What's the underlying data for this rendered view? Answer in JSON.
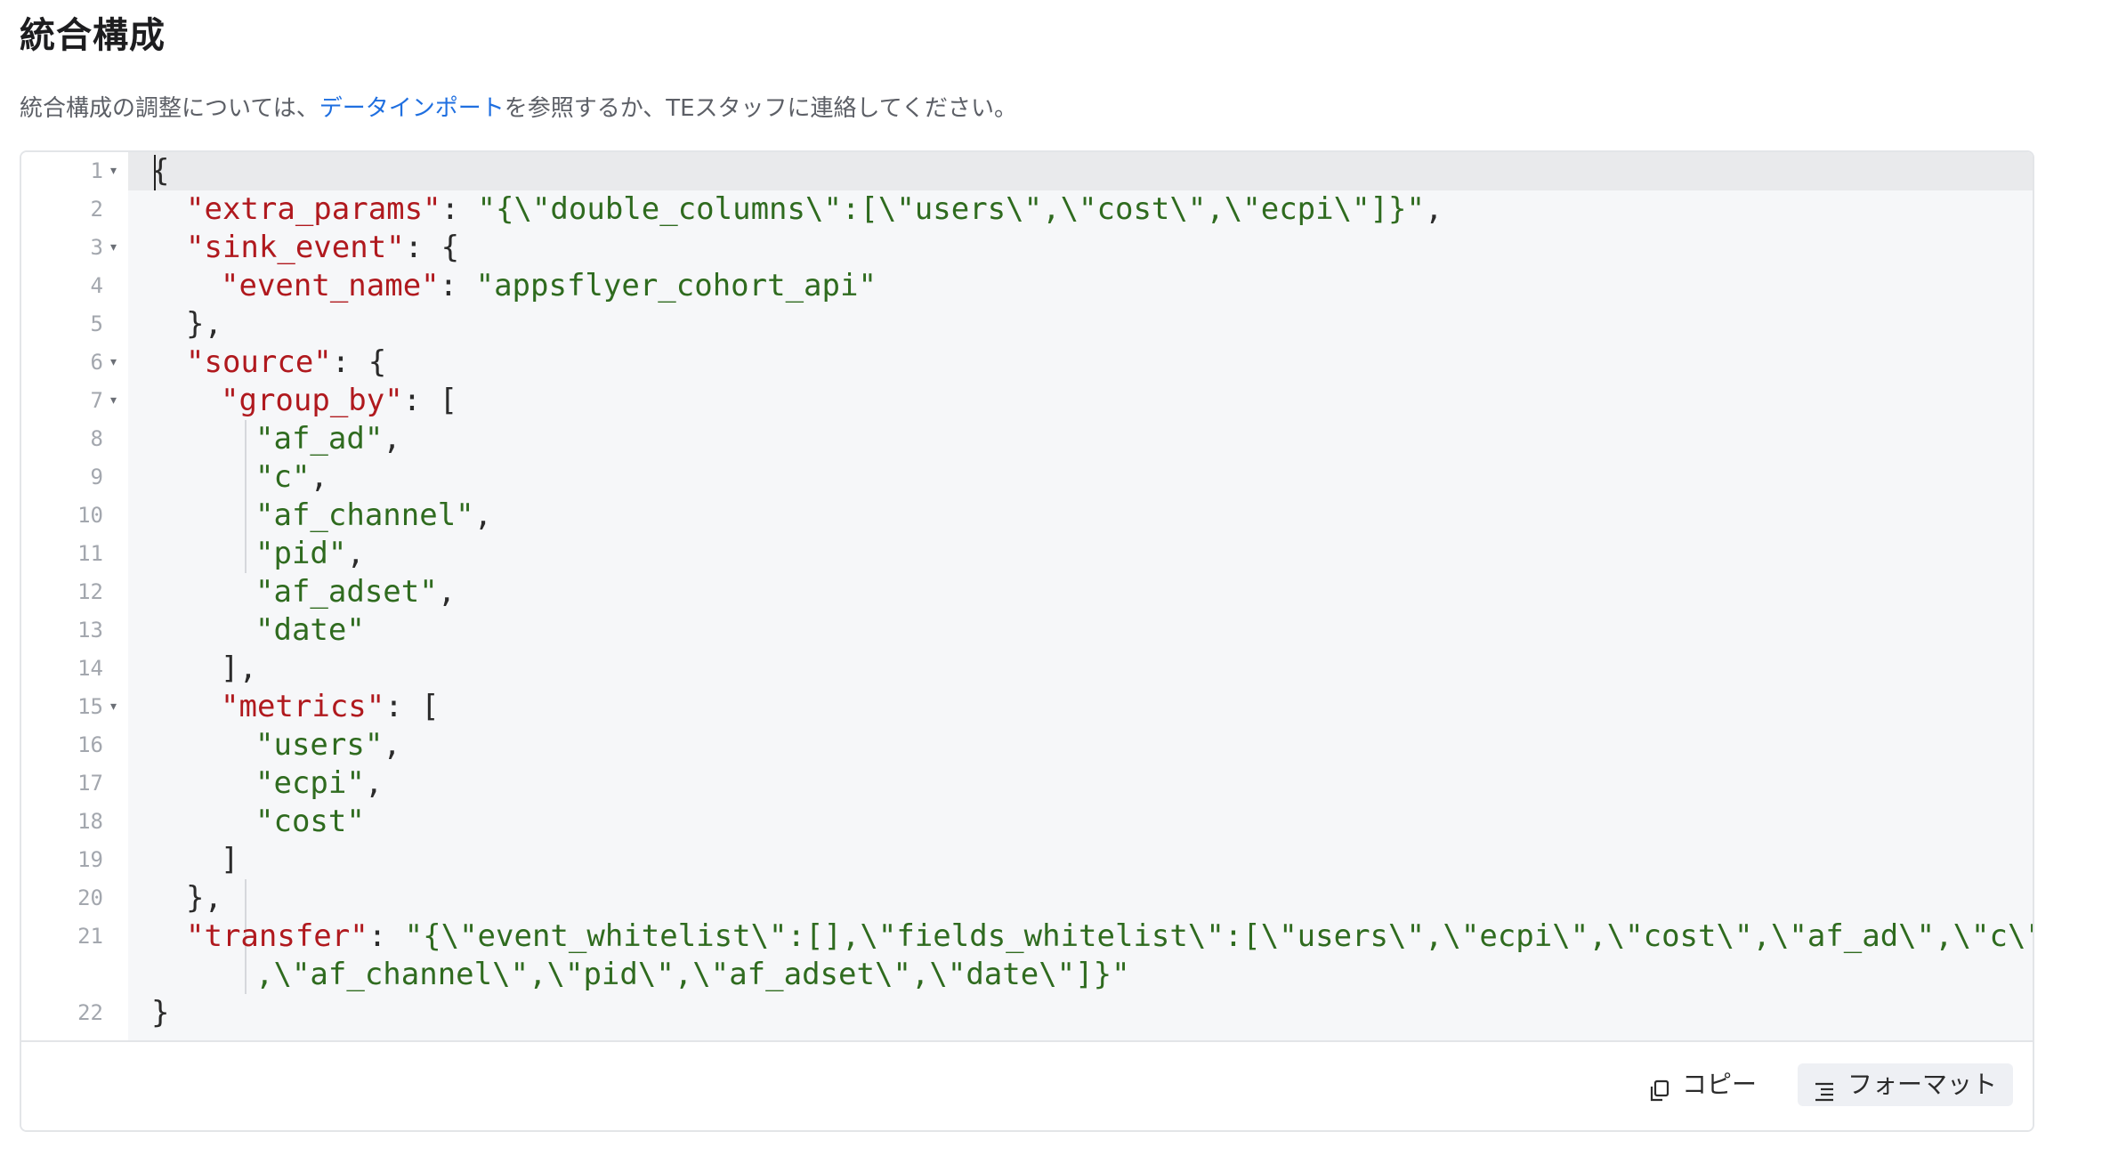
{
  "page": {
    "title": "統合構成",
    "desc_prefix": "統合構成の調整については、",
    "desc_link": "データインポート",
    "desc_suffix": "を参照するか、TEスタッフに連絡してください。"
  },
  "editor": {
    "lines": [
      {
        "n": "1",
        "fold": true
      },
      {
        "n": "2"
      },
      {
        "n": "3",
        "fold": true
      },
      {
        "n": "4"
      },
      {
        "n": "5"
      },
      {
        "n": "6",
        "fold": true
      },
      {
        "n": "7",
        "fold": true
      },
      {
        "n": "8"
      },
      {
        "n": "9"
      },
      {
        "n": "10"
      },
      {
        "n": "11"
      },
      {
        "n": "12"
      },
      {
        "n": "13"
      },
      {
        "n": "14"
      },
      {
        "n": "15",
        "fold": true
      },
      {
        "n": "16"
      },
      {
        "n": "17"
      },
      {
        "n": "18"
      },
      {
        "n": "19"
      },
      {
        "n": "20"
      },
      {
        "n": "21"
      },
      {
        "n": "22"
      }
    ],
    "code": {
      "l1": "{",
      "l2_key": "\"extra_params\"",
      "l2_val": "\"{\\\"double_columns\\\":[\\\"users\\\",\\\"cost\\\",\\\"ecpi\\\"]}\"",
      "l3_key": "\"sink_event\"",
      "l4_key": "\"event_name\"",
      "l4_val": "\"appsflyer_cohort_api\"",
      "l5": "},",
      "l6_key": "\"source\"",
      "l7_key": "\"group_by\"",
      "l8": "\"af_ad\"",
      "l9": "\"c\"",
      "l10": "\"af_channel\"",
      "l11": "\"pid\"",
      "l12": "\"af_adset\"",
      "l13": "\"date\"",
      "l14": "],",
      "l15_key": "\"metrics\"",
      "l16": "\"users\"",
      "l17": "\"ecpi\"",
      "l18": "\"cost\"",
      "l19": "]",
      "l20": "},",
      "l21_key": "\"transfer\"",
      "l21_val_a": "\"{\\\"event_whitelist\\\":[],\\\"fields_whitelist\\\":[\\\"users\\\",\\\"ecpi\\\",\\\"cost\\\",\\\"af_ad\\\",\\\"c\\\"",
      "l21_val_b": ",\\\"af_channel\\\",\\\"pid\\\",\\\"af_adset\\\",\\\"date\\\"]}\"",
      "l22": "}"
    }
  },
  "footer": {
    "copy_label": "コピー",
    "format_label": "フォーマット"
  },
  "colors": {
    "key": "#b0191e",
    "string": "#2f6b1f",
    "link": "#1f6fe0"
  }
}
